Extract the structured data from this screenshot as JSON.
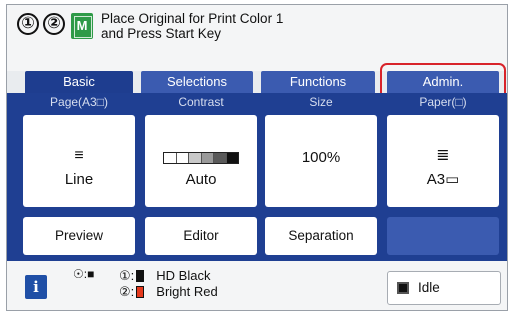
{
  "header": {
    "steps": [
      "①",
      "②"
    ],
    "mode_icon": "M",
    "message_line1": "Place Original for Print Color 1",
    "message_line2": "and Press Start Key"
  },
  "tabs": [
    {
      "label": "Basic",
      "selected": true
    },
    {
      "label": "Selections",
      "selected": false
    },
    {
      "label": "Functions",
      "selected": false
    },
    {
      "label": "Admin.",
      "selected": false
    }
  ],
  "settings": {
    "page": {
      "label": "Page(A3□)",
      "icon": "≡",
      "value": "Line"
    },
    "contrast": {
      "label": "Contrast",
      "value": "Auto"
    },
    "size": {
      "label": "Size",
      "value": "100%"
    },
    "paper": {
      "label": "Paper(□)",
      "icon": "≣",
      "value": "A3▭"
    }
  },
  "actions": {
    "preview": "Preview",
    "editor": "Editor",
    "separation": "Separation"
  },
  "footer": {
    "info_label": "i",
    "drum_icon": "☉:■",
    "ink1_num": "①:",
    "ink1_name": "HD Black",
    "ink2_num": "②:",
    "ink2_name": "Bright Red",
    "status": "Idle"
  },
  "colors": {
    "panel_blue": "#1f3f92",
    "tab_blue": "#3b5bb0",
    "highlight_red": "#d8232a",
    "mode_green": "#2e9a47",
    "ink_red": "#e53a1e"
  }
}
